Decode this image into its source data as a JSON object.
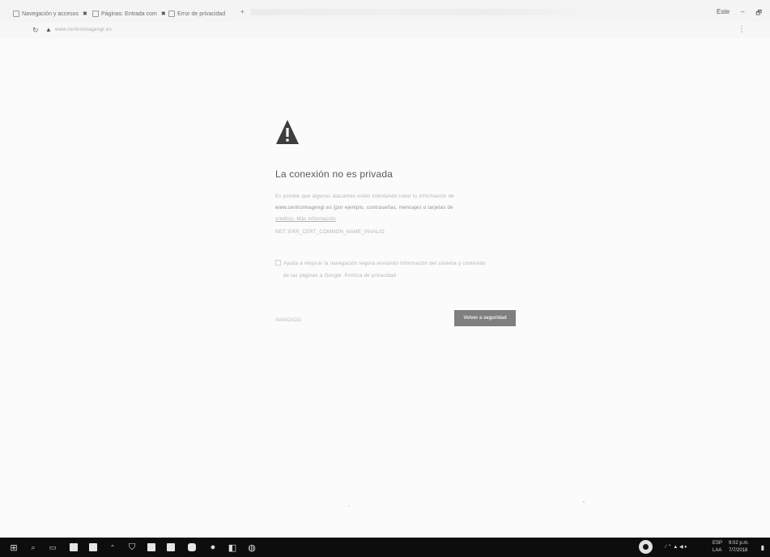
{
  "browser": {
    "tabs": [
      {
        "title": "Navegación y accesos"
      },
      {
        "title": "Páginas: Entrada com"
      },
      {
        "title": "Error de privacidad"
      }
    ],
    "new_tab_label": "+",
    "tab_close_glyph": "✖",
    "window_controls": [
      "Este",
      "–",
      "🗗"
    ],
    "address_url": "www.centroimagengr.es"
  },
  "error_page": {
    "icon": "warning-triangle-icon",
    "heading": "La conexión no es privada",
    "body_lines": [
      "Es posible que algunos atacantes estén intentando robar tu información de",
      "www.centroimagengr.es (por ejemplo, contraseñas, mensajes o tarjetas de",
      "crédito). Más información",
      "NET::ERR_CERT_COMMON_NAME_INVALID"
    ],
    "checkbox_label_lines": [
      "Ayuda a mejorar la navegación segura enviando información del sistema y contenido",
      "de las páginas a Google. Política de privacidad"
    ],
    "advanced_link": "AVANZADO",
    "back_button": "Volver a seguridad"
  },
  "taskbar": {
    "icons": [
      "windows-start-icon",
      "search-icon",
      "task-view-icon",
      "store-icon",
      "mail-icon",
      "up-arrow-icon",
      "shield-icon",
      "app-icon",
      "app-icon",
      "outlook-icon",
      "chrome-icon",
      "app-icon",
      "app-icon"
    ],
    "tray_time": "9:02 p.m.",
    "tray_date": "7/7/2018",
    "tray_lang": "ESP",
    "tray_sub": "LAA"
  }
}
